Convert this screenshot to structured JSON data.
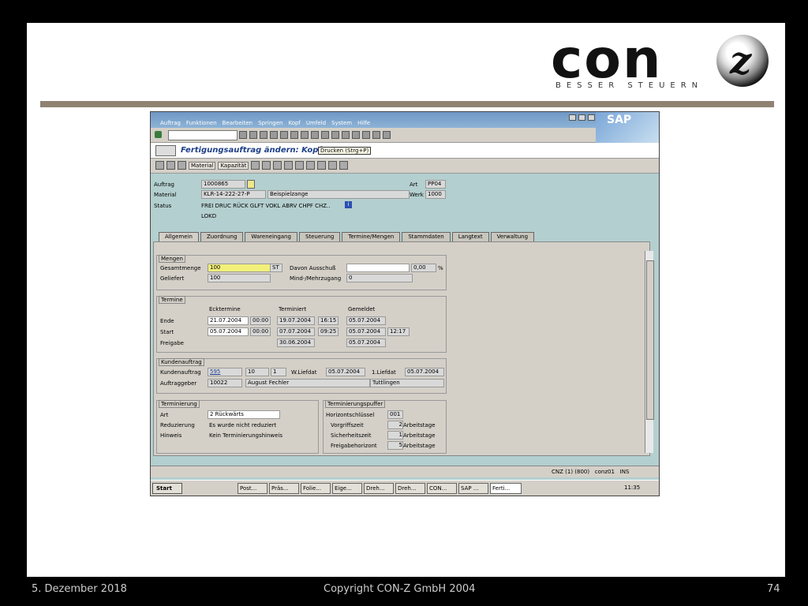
{
  "logo": {
    "word": "con",
    "letter": "z",
    "tagline": "BESSER STEUERN"
  },
  "footer": {
    "date": "5. Dezember 2018",
    "copyright": "Copyright CON-Z GmbH 2004",
    "page": "74"
  },
  "sap": {
    "brand": "SAP",
    "menu": [
      "Auftrag",
      "Funktionen",
      "Bearbeiten",
      "Springen",
      "Kopf",
      "Umfeld",
      "System",
      "Hilfe"
    ],
    "title": "Fertigungsauftrag ändern: Kopf",
    "tooltip": "Drucken  (Strg+P)",
    "toolbar2": {
      "material": "Material",
      "kapazitaet": "Kapazität"
    },
    "header": {
      "auftrag_label": "Auftrag",
      "auftrag": "1000865",
      "material_label": "Material",
      "material": "KLR-14-222-27-P",
      "material_desc": "Beispielzange",
      "status_label": "Status",
      "status": "FREI DRUC RÜCK GLFT VOKL ABRV CHPF CHZ..",
      "status2": "LOKD",
      "art_label": "Art",
      "art": "PP04",
      "werk_label": "Werk",
      "werk": "1000"
    },
    "tabs": [
      "Allgemein",
      "Zuordnung",
      "Wareneingang",
      "Steuerung",
      "Termine/Mengen",
      "Stammdaten",
      "Langtext",
      "Verwaltung"
    ],
    "mengen": {
      "caption": "Mengen",
      "gesamt_label": "Gesamtmenge",
      "gesamt": "100",
      "einheit": "ST",
      "ausschuss_label": "Davon Ausschuß",
      "ausschuss": "",
      "ausschuss_pct": "0,00",
      "pct": "%",
      "geliefert_label": "Geliefert",
      "geliefert": "100",
      "mehr_label": "Mind-/Mehrzugang",
      "mehr": "0"
    },
    "termine": {
      "caption": "Termine",
      "col1": "Ecktermine",
      "col2": "Terminiert",
      "col3": "Gemeldet",
      "ende_label": "Ende",
      "ende1": "21.07.2004",
      "ende1t": "00:00",
      "ende2": "19.07.2004",
      "ende2t": "16:15",
      "ende3": "05.07.2004",
      "start_label": "Start",
      "start1": "05.07.2004",
      "start1t": "00:00",
      "start2": "07.07.2004",
      "start2t": "09:25",
      "start3": "05.07.2004",
      "start3t": "12:17",
      "freigabe_label": "Freigabe",
      "freigabe2": "30.06.2004",
      "freigabe3": "05.07.2004"
    },
    "kunden": {
      "caption": "Kundenauftrag",
      "ka_label": "Kundenauftrag",
      "ka": "595",
      "pos": "10",
      "ein": "1",
      "wliefdat_label": "W.Liefdat",
      "wliefdat": "05.07.2004",
      "liefdat_label": "1.Liefdat",
      "liefdat": "05.07.2004",
      "ag_label": "Auftraggeber",
      "ag": "10022",
      "ag_name": "August Fechler",
      "ag_ort": "Tuttlingen"
    },
    "terminierung": {
      "caption": "Terminierung",
      "art_label": "Art",
      "art": "2 Rückwärts",
      "red_label": "Reduzierung",
      "red": "Es wurde nicht reduziert",
      "hin_label": "Hinweis",
      "hin": "Kein Terminierungshinweis"
    },
    "puffer": {
      "caption": "Terminierungspuffer",
      "hs_label": "Horizontschlüssel",
      "hs": "001",
      "vor_label": "Vorgriffszeit",
      "vor": "2",
      "vor_u": "Arbeitstage",
      "sich_label": "Sicherheitszeit",
      "sich": "1",
      "sich_u": "Arbeitstage",
      "frei_label": "Freigabehorizont",
      "frei": "5",
      "frei_u": "Arbeitstage"
    },
    "status": {
      "system": "CNZ (1) (800)",
      "user": "conz01",
      "mode": "INS"
    },
    "taskbar": {
      "start": "Start",
      "tasks": [
        "Post...",
        "Präs...",
        "Folie...",
        "Eige...",
        "Dreh...",
        "Dreh...",
        "CON...",
        "SAP ...",
        "Ferti..."
      ],
      "clock": "11:35"
    }
  }
}
